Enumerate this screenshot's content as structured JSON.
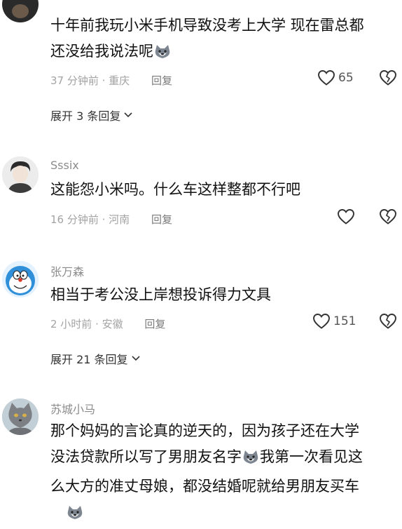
{
  "comments": [
    {
      "username": "",
      "lines": [
        "十年前我玩小米手机导致没考上大学 现在雷总都",
        "还没给我说法呢"
      ],
      "time": "37 分钟前 · 重庆",
      "reply": "回复",
      "likes": "65",
      "expand": "展开 3 条回复"
    },
    {
      "username": "Sssix",
      "lines": [
        "这能怨小米吗。什么车这样整都不行吧"
      ],
      "time": "16 分钟前 · 河南",
      "reply": "回复",
      "likes": "",
      "expand": ""
    },
    {
      "username": "张万森",
      "lines": [
        "相当于考公没上岸想投诉得力文具"
      ],
      "time": "2 小时前 · 安徽",
      "reply": "回复",
      "likes": "151",
      "expand": "展开 21 条回复"
    },
    {
      "username": "苏城小马",
      "lines": [
        "那个妈妈的言论真的逆天的，因为孩子还在大学",
        "没法贷款所以写了男朋友名字",
        "我第一次看见这",
        "么大方的准丈母娘，都没结婚呢就给男朋友买车"
      ],
      "time": "",
      "reply": "",
      "likes": "",
      "expand": ""
    }
  ],
  "icons": {
    "like": "heart-outline-icon",
    "dislike": "broken-heart-icon",
    "expand": "chevron-down-icon",
    "emoji": "husky-emoji-icon"
  }
}
